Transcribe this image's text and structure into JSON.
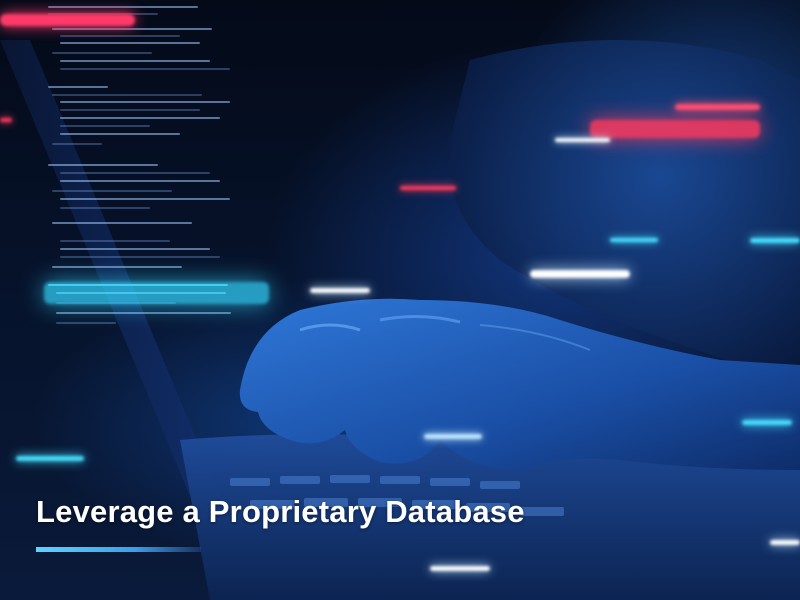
{
  "caption": {
    "title": "Leverage a Proprietary Database"
  },
  "colors": {
    "accent_cyan": "#46e0ff",
    "accent_red": "#ff3a5e",
    "background": "#050b1a",
    "underline": "#5fd4ff"
  }
}
